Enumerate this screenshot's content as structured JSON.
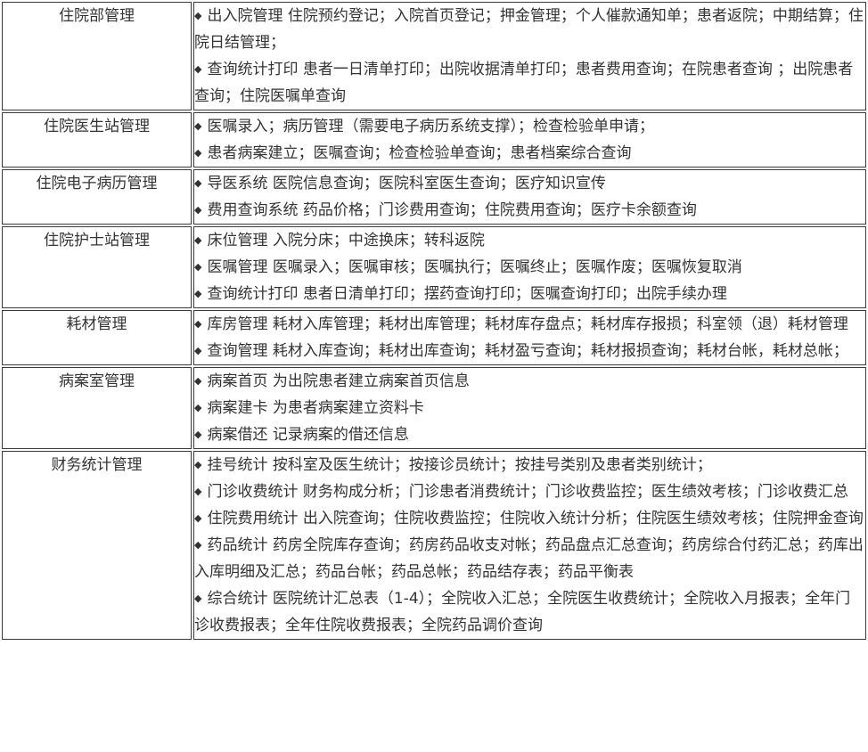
{
  "table": {
    "rows": [
      {
        "module": "住院部管理",
        "items": [
          "出入院管理 住院预约登记；入院首页登记；押金管理；个人催款通知单；患者返院；中期结算；住院日结管理；",
          "查询统计打印 患者一日清单打印；出院收据清单打印；患者费用查询；在院患者查询 ；出院患者查询；住院医嘱单查询"
        ]
      },
      {
        "module": "住院医生站管理",
        "items": [
          "医嘱录入；病历管理（需要电子病历系统支撑）；检查检验单申请；",
          "患者病案建立；医嘱查询；检查检验单查询；患者档案综合查询"
        ]
      },
      {
        "module": "住院电子病历管理",
        "items": [
          "导医系统 医院信息查询；医院科室医生查询；医疗知识宣传",
          "费用查询系统 药品价格；门诊费用查询；住院费用查询；医疗卡余额查询"
        ]
      },
      {
        "module": "住院护士站管理",
        "items": [
          "床位管理 入院分床；中途换床；转科返院",
          "医嘱管理 医嘱录入；医嘱审核；医嘱执行；医嘱终止；医嘱作废；医嘱恢复取消",
          "查询统计打印 患者日清单打印；摆药查询打印；医嘱查询打印；出院手续办理"
        ]
      },
      {
        "module": "耗材管理",
        "items": [
          "库房管理 耗材入库管理；耗材出库管理；耗材库存盘点；耗材库存报损；科室领（退）耗材管理",
          "查询管理 耗材入库查询；耗材出库查询；耗材盈亏查询；耗材报损查询；耗材台帐，耗材总帐；"
        ]
      },
      {
        "module": "病案室管理",
        "items": [
          "病案首页 为出院患者建立病案首页信息",
          "病案建卡 为患者病案建立资料卡",
          "病案借还 记录病案的借还信息"
        ]
      },
      {
        "module": "财务统计管理",
        "items": [
          "挂号统计 按科室及医生统计；按接诊员统计；按挂号类别及患者类别统计；",
          "门诊收费统计 财务构成分析；门诊患者消费统计；门诊收费监控；医生绩效考核；门诊收费汇总",
          "住院费用统计 出入院查询；住院收费监控；住院收入统计分析；住院医生绩效考核；住院押金查询",
          "药品统计 药房全院库存查询；药房药品收支对帐；药品盘点汇总查询；药房综合付药汇总；药库出入库明细及汇总；药品台帐；药品总帐；药品结存表；药品平衡表",
          "综合统计 医院统计汇总表（1-4）；全院收入汇总；全院医生收费统计；全院收入月报表；全年门诊收费报表；全年住院收费报表；全院药品调价查询"
        ]
      }
    ]
  }
}
